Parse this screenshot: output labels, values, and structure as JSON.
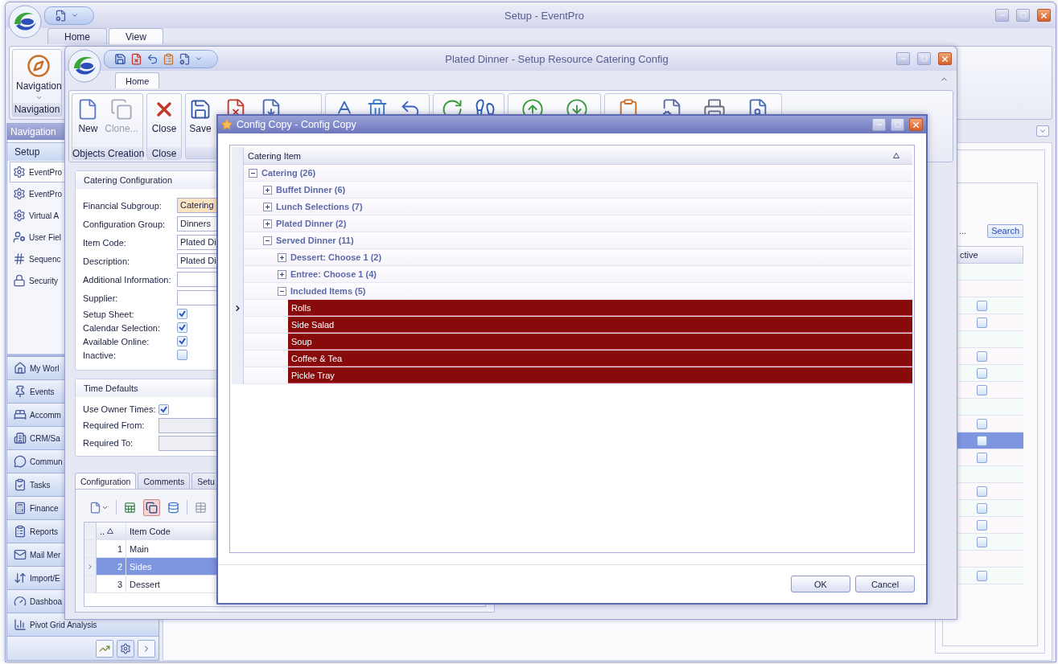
{
  "main_window": {
    "title": "Setup - EventPro",
    "tabs": [
      {
        "label": "Home",
        "selected": false
      },
      {
        "label": "View",
        "selected": true
      }
    ],
    "ribbon": {
      "button": "Navigation",
      "group": "Navigation"
    },
    "navigation": {
      "header": "Navigation",
      "section": "Setup",
      "items": [
        {
          "label": "EventPro",
          "selected": true
        },
        {
          "label": "EventPro",
          "selected": false
        },
        {
          "label": "Virtual A",
          "selected": false
        },
        {
          "label": "User Fiel",
          "selected": false
        },
        {
          "label": "Sequenc",
          "selected": false
        },
        {
          "label": "Security",
          "selected": false
        }
      ],
      "modules": [
        "My Worl",
        "Events",
        "Accomm",
        "CRM/Sa",
        "Commun",
        "Tasks",
        "Finance",
        "Reports",
        "Mail Mer",
        "Import/E",
        "Dashboa",
        "Pivot Grid Analysis"
      ]
    },
    "grid": {
      "search_placeholder": "...",
      "search_button": "Search",
      "column": "ctive",
      "rows": [
        {
          "kind": "blank",
          "selected": false
        },
        {
          "kind": "blank",
          "selected": false
        },
        {
          "kind": "check",
          "checked": false,
          "selected": false
        },
        {
          "kind": "check",
          "checked": false,
          "selected": false
        },
        {
          "kind": "blank",
          "selected": false
        },
        {
          "kind": "check",
          "checked": false,
          "selected": false
        },
        {
          "kind": "check",
          "checked": false,
          "selected": false
        },
        {
          "kind": "check",
          "checked": false,
          "selected": false
        },
        {
          "kind": "blank",
          "selected": false
        },
        {
          "kind": "check",
          "checked": false,
          "selected": false
        },
        {
          "kind": "check",
          "checked": false,
          "selected": true
        },
        {
          "kind": "check",
          "checked": false,
          "selected": false
        },
        {
          "kind": "blank",
          "selected": false
        },
        {
          "kind": "check",
          "checked": false,
          "selected": false
        },
        {
          "kind": "check",
          "checked": false,
          "selected": false
        },
        {
          "kind": "check",
          "checked": false,
          "selected": false
        },
        {
          "kind": "check",
          "checked": false,
          "selected": false
        },
        {
          "kind": "blank",
          "selected": false
        },
        {
          "kind": "check",
          "checked": false,
          "selected": false
        }
      ]
    }
  },
  "editor_window": {
    "title": "Plated Dinner - Setup Resource Catering Config",
    "tabs": [
      {
        "label": "Home",
        "selected": true
      }
    ],
    "ribbon_groups": [
      {
        "label": "Objects Creation",
        "buttons": [
          {
            "label": "New",
            "disabled": false
          },
          {
            "label": "Clone...",
            "disabled": true
          }
        ]
      },
      {
        "label": "Close",
        "buttons": [
          {
            "label": "Close",
            "disabled": false
          }
        ]
      },
      {
        "buttons": [
          {
            "label": "Save",
            "disabled": false
          }
        ]
      }
    ],
    "catering_configuration": {
      "title": "Catering Configuration",
      "fields": [
        {
          "kind": "text",
          "label": "Financial Subgroup:",
          "value": "Catering",
          "focused": true
        },
        {
          "kind": "text",
          "label": "Configuration Group:",
          "value": "Dinners",
          "focused": false
        },
        {
          "kind": "text",
          "label": "Item Code:",
          "value": "Plated Di",
          "focused": false
        },
        {
          "kind": "text",
          "label": "Description:",
          "value": "Plated Di",
          "focused": false
        },
        {
          "kind": "text",
          "label": "Additional Information:",
          "focused": false
        },
        {
          "kind": "text",
          "label": "Supplier:",
          "focused": false
        },
        {
          "kind": "check",
          "label": "Setup Sheet:",
          "checked": true
        },
        {
          "kind": "check",
          "label": "Calendar Selection:",
          "checked": true
        },
        {
          "kind": "check",
          "label": "Available Online:",
          "checked": true
        },
        {
          "kind": "check",
          "label": "Inactive:",
          "checked": false
        }
      ]
    },
    "time_defaults": {
      "title": "Time Defaults",
      "fields": [
        {
          "kind": "check",
          "label": "Use Owner Times:",
          "checked": true
        },
        {
          "kind": "text",
          "label": "Required From:",
          "disabled": true
        },
        {
          "kind": "text",
          "label": "Required To:",
          "disabled": true
        }
      ]
    },
    "tabs_bottom": [
      {
        "label": "Configuration",
        "selected": true
      },
      {
        "label": "Comments",
        "selected": false
      },
      {
        "label": "Setu",
        "selected": false
      }
    ],
    "grid": {
      "columns": [
        "..",
        "Item Code"
      ],
      "rows": [
        {
          "number": "1",
          "code": "Main",
          "selected": false
        },
        {
          "number": "2",
          "code": "Sides",
          "selected": true
        },
        {
          "number": "3",
          "code": "Dessert",
          "selected": false
        }
      ]
    }
  },
  "dialog": {
    "title": "Config Copy - Config Copy",
    "column": "Catering Item",
    "tree": [
      {
        "label": "Catering (26)",
        "expanded": true,
        "children": [
          {
            "label": "Buffet Dinner (6)",
            "expanded": false
          },
          {
            "label": "Lunch Selections (7)",
            "expanded": false
          },
          {
            "label": "Plated Dinner (2)",
            "expanded": false
          },
          {
            "label": "Served Dinner (11)",
            "expanded": true,
            "children": [
              {
                "label": "Dessert: Choose 1 (2)",
                "expanded": false
              },
              {
                "label": "Entree: Choose 1 (4)",
                "expanded": false
              },
              {
                "label": "Included Items (5)",
                "expanded": true,
                "children": [
                  {
                    "label": "Rolls",
                    "selected": true,
                    "current": true
                  },
                  {
                    "label": "Side Salad",
                    "selected": true,
                    "current": false
                  },
                  {
                    "label": "Soup",
                    "selected": true,
                    "current": false
                  },
                  {
                    "label": "Coffee & Tea",
                    "selected": true,
                    "current": false
                  },
                  {
                    "label": "Pickle Tray",
                    "selected": true,
                    "current": false
                  }
                ]
              }
            ]
          }
        ]
      }
    ],
    "buttons": [
      "OK",
      "Cancel"
    ]
  }
}
